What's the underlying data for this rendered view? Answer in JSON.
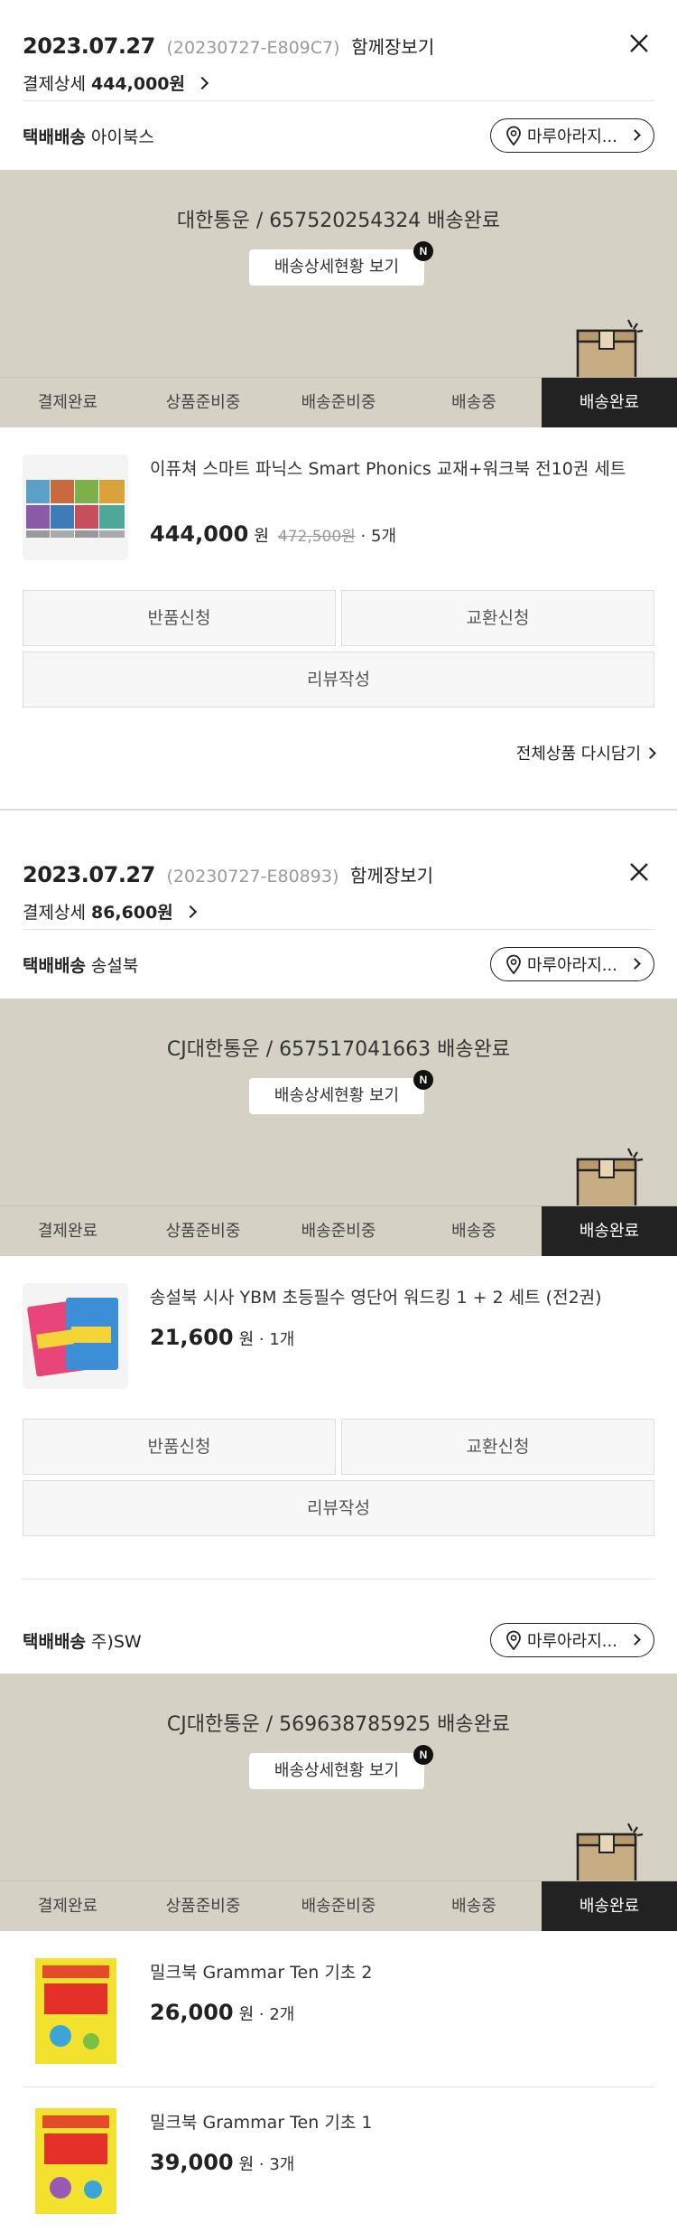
{
  "common": {
    "store_label": "마루아라지...",
    "track_button": "배송상세현황 보기",
    "new_badge": "N",
    "steps": [
      "결제완료",
      "상품준비중",
      "배송준비중",
      "배송중",
      "배송완료"
    ],
    "won": "원",
    "return_button": "반품신청",
    "exchange_button": "교환신청",
    "review_button": "리뷰작성",
    "delivery_type": "택배배송",
    "cart_link": "함께장보기",
    "payment_label": "결제상세"
  },
  "orders": [
    {
      "date": "2023.07.27",
      "order_id": "(20230727-E809C7)",
      "payment_amount": "444,000원",
      "reorder_link": "전체상품 다시담기",
      "shipments": [
        {
          "seller": "아이북스",
          "tracking": "대한통운 / 657520254324 배송완료",
          "items": [
            {
              "name": "이퓨쳐 스마트 파닉스 Smart Phonics 교재+워크북 전10권 세트",
              "price": "444,000",
              "original_price": "472,500원",
              "qty": " · 5개"
            }
          ]
        }
      ]
    },
    {
      "date": "2023.07.27",
      "order_id": "(20230727-E80893)",
      "payment_amount": "86,600원",
      "shipments": [
        {
          "seller": "송설북",
          "tracking": "CJ대한통운 / 657517041663 배송완료",
          "items": [
            {
              "name": "송설북 시사 YBM 초등필수 영단어 워드킹 1 + 2 세트 (전2권)",
              "price": "21,600",
              "qty": " · 1개"
            }
          ]
        },
        {
          "seller": "주)SW",
          "tracking": "CJ대한통운 / 569638785925 배송완료",
          "items": [
            {
              "name": "밀크북 Grammar Ten 기초 2",
              "price": "26,000",
              "qty": " · 2개"
            },
            {
              "name": "밀크북 Grammar Ten 기초 1",
              "price": "39,000",
              "qty": " · 3개"
            }
          ]
        }
      ]
    }
  ]
}
